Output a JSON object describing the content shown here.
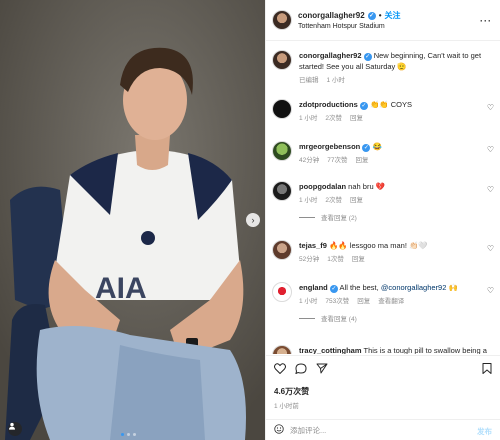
{
  "header": {
    "username": "conorgallagher92",
    "separator": "•",
    "follow_label": "关注",
    "location": "Tottenham Hotspur Stadium"
  },
  "caption": {
    "username": "conorgallagher92",
    "text": "New beginning, Can't wait to get started! See you all Saturday",
    "emoji": "🫡",
    "edited": "已编辑",
    "time": "1 小时"
  },
  "comments": [
    {
      "username": "zdotproductions",
      "verified": true,
      "text": "👏👏 COYS",
      "time": "1 小时",
      "likes": "2次赞",
      "reply": "回复"
    },
    {
      "username": "mrgeorgebenson",
      "verified": true,
      "text": "😂",
      "time": "42分钟",
      "likes": "77次赞",
      "reply": "回复"
    },
    {
      "username": "poopgodalan",
      "verified": false,
      "text": "nah bru 💔",
      "time": "1 小时",
      "likes": "2次赞",
      "reply": "回复",
      "view_replies": "查看回复 (2)"
    },
    {
      "username": "tejas_f9",
      "verified": false,
      "text": "🔥🔥 lessgoo ma man! 👏🏻🤍",
      "time": "52分钟",
      "likes": "1次赞",
      "reply": "回复"
    },
    {
      "username": "england",
      "verified": true,
      "text": "All the best, ",
      "mention": "@conorgallagher92",
      "text_after": " 🙌",
      "time": "1 小时",
      "likes": "753次赞",
      "reply": "回复",
      "translate": "查看翻译",
      "view_replies": "查看回复 (4)"
    },
    {
      "username": "tracy_cottingham",
      "verified": false,
      "text": "This is a tough pill to swallow being a",
      "time": "",
      "likes": "",
      "reply": ""
    }
  ],
  "footer": {
    "likes": "4.6万次赞",
    "time": "1 小时前",
    "emoji_icon": "smiley-icon",
    "comment_placeholder": "添加评论...",
    "post_label": "发布"
  },
  "carousel": {
    "slide_count": 3,
    "active_index": 1
  },
  "colors": {
    "accent": "#0095f6",
    "verified": "#3897f0",
    "muted": "#8e8e8e"
  }
}
